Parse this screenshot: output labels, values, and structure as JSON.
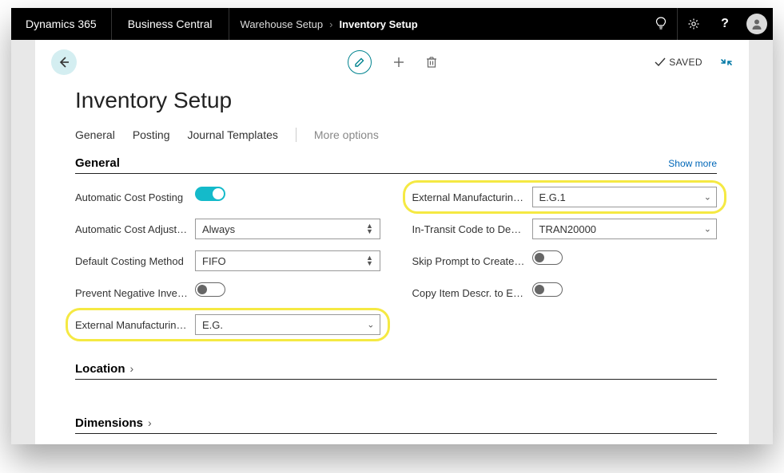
{
  "header": {
    "brand1": "Dynamics 365",
    "brand2": "Business Central",
    "crumb1": "Warehouse Setup",
    "crumb2": "Inventory Setup"
  },
  "toolbar": {
    "saved_label": "SAVED"
  },
  "page": {
    "title": "Inventory Setup"
  },
  "tabs": {
    "general": "General",
    "posting": "Posting",
    "journal_templates": "Journal Templates",
    "more": "More options"
  },
  "sections": {
    "general": {
      "title": "General",
      "show_more": "Show more"
    },
    "location": {
      "title": "Location"
    },
    "dimensions": {
      "title": "Dimensions"
    }
  },
  "fields": {
    "auto_cost_posting_label": "Automatic Cost Posting",
    "auto_cost_adjust_label": "Automatic Cost Adjustm...",
    "auto_cost_adjust_value": "Always",
    "default_costing_label": "Default Costing Method",
    "default_costing_value": "FIFO",
    "prevent_neg_label": "Prevent Negative Invent...",
    "ext_mfg_j1_label": "External Manufacturing J...",
    "ext_mfg_j1_value": "E.G.",
    "ext_mfg_j2_label": "External Manufacturing J...",
    "ext_mfg_j2_value": "E.G.1",
    "in_transit_label": "In-Transit Code to Deposit",
    "in_transit_value": "TRAN20000",
    "skip_prompt_label": "Skip Prompt to Create It...",
    "copy_item_label": "Copy Item Descr. to Entri..."
  }
}
